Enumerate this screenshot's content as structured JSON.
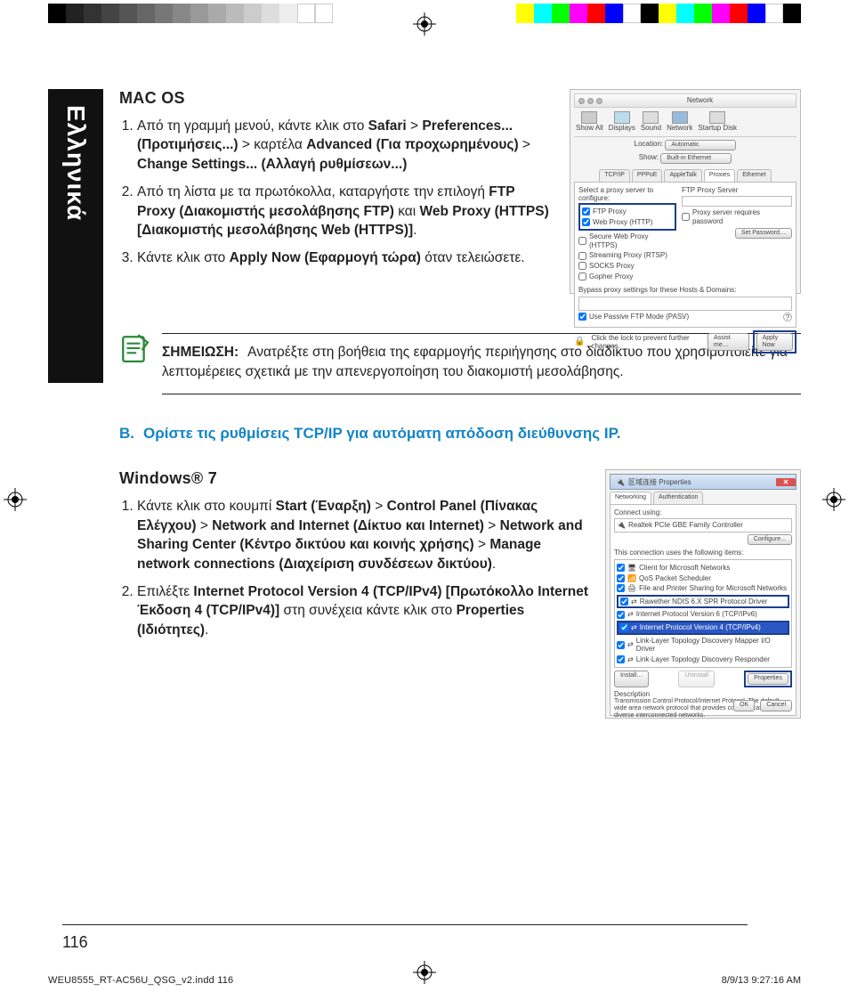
{
  "sidebar_language": "Ελληνικά",
  "macos": {
    "heading": "MAC OS",
    "step1_prefix": "Από τη γραμμή μενού, κάντε κλικ στο ",
    "safari": "Safari",
    "prefs": "Preferences... (Προτιμήσεις...)",
    "kartela": " > καρτέλα ",
    "advanced": "Advanced (Για προχωρημένους)",
    "change": "Change Settings... (Αλλαγή ρυθμίσεων...)",
    "step2_prefix": "Από τη λίστα με τα πρωτόκολλα, καταργήστε την επιλογή ",
    "ftp": "FTP Proxy (Διακομιστής μεσολάβησης FTP)",
    "kai": " και ",
    "web": "Web Proxy (HTTPS) [Διακομιστής μεσολάβησης Web (HTTPS)]",
    "step3_prefix": "Κάντε κλικ στο ",
    "apply": "Apply Now (Εφαρμογή τώρα)",
    "step3_suffix": " όταν τελειώσετε."
  },
  "note": {
    "label": "ΣΗΜΕΙΩΣΗ:",
    "text": "Ανατρέξτε στη βοήθεια της εφαρμογής περιήγησης στο διαδίκτυο που χρησιμοποιείτε για λεπτομέρειες σχετικά με την απενεργοποίηση του διακομιστή μεσολάβησης."
  },
  "sectionB": {
    "lead": "B.",
    "text": "Ορίστε τις ρυθμίσεις TCP/IP για αυτόματη απόδοση διεύθυνσης IP."
  },
  "win7": {
    "heading": "Windows® 7",
    "s1_a": "Κάντε κλικ στο κουμπί ",
    "start": "Start (Έναρξη)",
    "cp": "Control Panel (Πίνακας Ελέγχου)",
    "ni": "Network and Internet (Δίκτυο και Internet)",
    "nsc": "Network and Sharing Center (Κέντρο δικτύου και κοινής χρήσης)",
    "mnc": "Manage network connections (Διαχείριση συνδέσεων δικτύου)",
    "s2_a": "Επιλέξτε ",
    "ipv4": "Internet Protocol Version 4 (TCP/IPv4) [Πρωτόκολλο Internet Έκδοση 4 (TCP/IPv4)]",
    "s2_b": " στη συνέχεια κάντε κλικ στο ",
    "props": "Properties (Ιδιότητες)"
  },
  "mac_shot": {
    "title": "Network",
    "show_all": "Show All",
    "displays": "Displays",
    "sound": "Sound",
    "network": "Network",
    "startup": "Startup Disk",
    "location": "Location:",
    "automatic": "Automatic",
    "show": "Show:",
    "bie": "Built-in Ethernet",
    "tabs": [
      "TCP/IP",
      "PPPoE",
      "AppleTalk",
      "Proxies",
      "Ethernet"
    ],
    "select": "Select a proxy server to configure:",
    "ftp_server": "FTP Proxy Server",
    "items": [
      "FTP Proxy",
      "Web Proxy (HTTP)",
      "Secure Web Proxy (HTTPS)",
      "Streaming Proxy (RTSP)",
      "SOCKS Proxy",
      "Gopher Proxy"
    ],
    "req_pw": "Proxy server requires password",
    "set_pw": "Set Password…",
    "bypass": "Bypass proxy settings for these Hosts & Domains:",
    "pasv": "Use Passive FTP Mode (PASV)",
    "lock": "Click the lock to prevent further changes.",
    "assist": "Assist me…",
    "apply": "Apply Now"
  },
  "win_shot": {
    "title": "区域连接 Properties",
    "t_net": "Networking",
    "t_auth": "Authentication",
    "connect": "Connect using:",
    "nic": "Realtek PCIe GBE Family Controller",
    "configure": "Configure...",
    "uses": "This connection uses the following items:",
    "items": [
      "Client for Microsoft Networks",
      "QoS Packet Scheduler",
      "File and Printer Sharing for Microsoft Networks",
      "Rawether NDIS 6.X SPR Protocol Driver",
      "Internet Protocol Version 6 (TCP/IPv6)",
      "Internet Protocol Version 4 (TCP/IPv4)",
      "Link-Layer Topology Discovery Mapper I/O Driver",
      "Link-Layer Topology Discovery Responder"
    ],
    "install": "Install…",
    "uninstall": "Uninstall",
    "properties": "Properties",
    "desc_l": "Description",
    "desc": "Transmission Control Protocol/Internet Protocol. The default wide area network protocol that provides communication across diverse interconnected networks.",
    "ok": "OK",
    "cancel": "Cancel"
  },
  "page_number": "116",
  "slug_left": "WEU8555_RT-AC56U_QSG_v2.indd   116",
  "slug_right": "8/9/13   9:27:16 AM",
  "gt": " > "
}
